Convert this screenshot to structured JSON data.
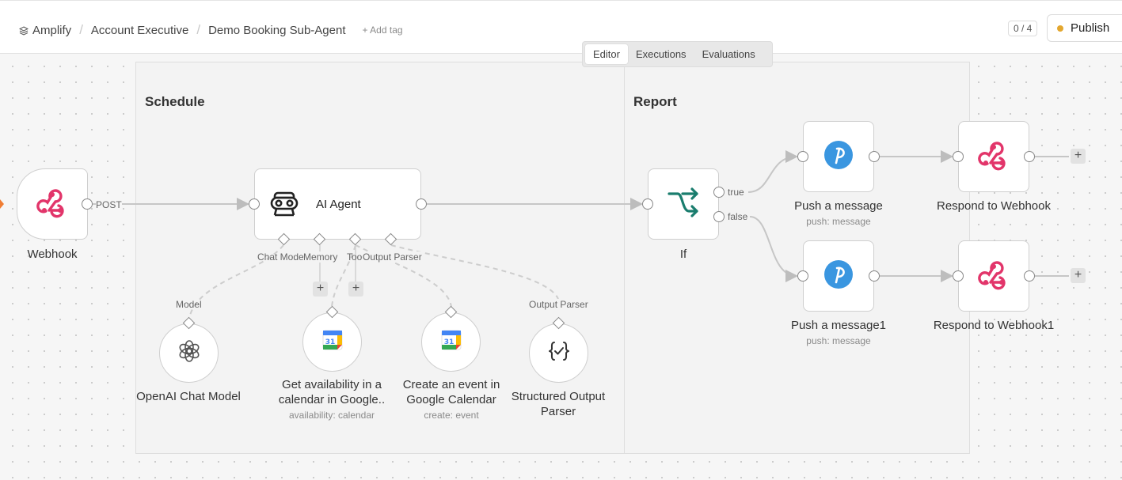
{
  "breadcrumb": {
    "project": "Amplify",
    "folder": "Account Executive",
    "workflow": "Demo Booking Sub-Agent",
    "add_tag": "+ Add tag"
  },
  "header": {
    "counter": "0 / 4",
    "publish_label": "Publish"
  },
  "tabs": [
    {
      "label": "Editor",
      "active": true
    },
    {
      "label": "Executions",
      "active": false
    },
    {
      "label": "Evaluations",
      "active": false
    }
  ],
  "groups": {
    "schedule": "Schedule",
    "report": "Report"
  },
  "nodes": {
    "webhook": {
      "label": "Webhook",
      "output_label": "POST"
    },
    "agent": {
      "label": "AI Agent",
      "ports": {
        "chat_model": "Chat Model",
        "memory": "Memory",
        "tool": "Tool",
        "output_parser": "Output Parser"
      }
    },
    "openai": {
      "label": "OpenAI Chat Model",
      "port_label": "Model"
    },
    "get_availability": {
      "label_line1": "Get availability in a",
      "label_line2": "calendar in Google..",
      "sub": "availability: calendar"
    },
    "create_event": {
      "label_line1": "Create an event in",
      "label_line2": "Google Calendar",
      "sub": "create: event"
    },
    "structured_parser": {
      "label_line1": "Structured Output",
      "label_line2": "Parser",
      "port_label": "Output Parser"
    },
    "if": {
      "label": "If",
      "true_label": "true",
      "false_label": "false"
    },
    "push1": {
      "label": "Push a message",
      "sub": "push: message"
    },
    "push2": {
      "label": "Push a message1",
      "sub": "push: message"
    },
    "respond1": {
      "label": "Respond to Webhook"
    },
    "respond2": {
      "label": "Respond to Webhook1"
    }
  },
  "colors": {
    "webhook": "#e2356a",
    "if_icon": "#1a7d6e",
    "push_icon": "#3a96e0",
    "publish_dot": "#e3a72f",
    "accent_arrow": "#f07d33"
  }
}
